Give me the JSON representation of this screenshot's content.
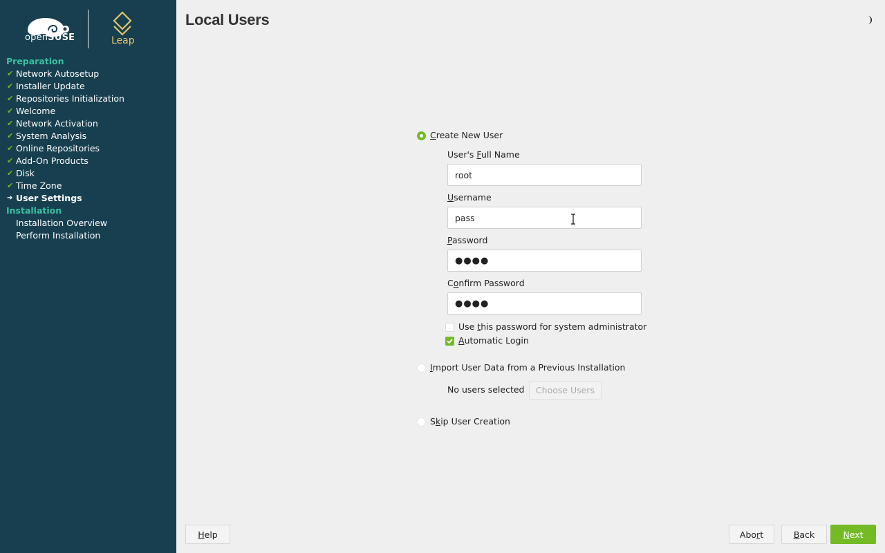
{
  "sidebar": {
    "brand_prefix": "open",
    "brand_suffix": "SUSE",
    "product": "Leap",
    "groups": [
      {
        "title": "Preparation",
        "items": [
          {
            "label": "Network Autosetup",
            "state": "done"
          },
          {
            "label": "Installer Update",
            "state": "done"
          },
          {
            "label": "Repositories Initialization",
            "state": "done"
          },
          {
            "label": "Welcome",
            "state": "done"
          },
          {
            "label": "Network Activation",
            "state": "done"
          },
          {
            "label": "System Analysis",
            "state": "done"
          },
          {
            "label": "Online Repositories",
            "state": "done"
          },
          {
            "label": "Add-On Products",
            "state": "done"
          },
          {
            "label": "Disk",
            "state": "done"
          },
          {
            "label": "Time Zone",
            "state": "done"
          },
          {
            "label": "User Settings",
            "state": "current"
          }
        ]
      },
      {
        "title": "Installation",
        "items": [
          {
            "label": "Installation Overview",
            "state": "pending"
          },
          {
            "label": "Perform Installation",
            "state": "pending"
          }
        ]
      }
    ],
    "done_mark": "✔",
    "current_mark": "➔"
  },
  "page": {
    "title": "Local Users",
    "theme_icon": "half-moon-icon"
  },
  "form": {
    "create_new_user": {
      "label_pre": "",
      "label_acc": "C",
      "label_post": "reate New User",
      "selected": true
    },
    "full_name": {
      "label_pre": "User's ",
      "label_acc": "F",
      "label_post": "ull Name",
      "value": "root"
    },
    "username": {
      "label_pre": "",
      "label_acc": "U",
      "label_post": "sername",
      "value": "pass"
    },
    "password": {
      "label_pre": "",
      "label_acc": "P",
      "label_post": "assword",
      "value": "●●●●"
    },
    "confirm_password": {
      "label_pre": "",
      "label_acc": "o",
      "label_post": "nfirm Password",
      "label_lead": "C",
      "value": "●●●●"
    },
    "admin_password": {
      "label_pre": "Use ",
      "label_acc": "t",
      "label_post": "his password for system administrator",
      "checked": false
    },
    "auto_login": {
      "label_pre": "",
      "label_acc": "A",
      "label_post": "utomatic Login",
      "checked": true
    },
    "import_user_data": {
      "label_pre": "",
      "label_acc": "I",
      "label_post": "mport User Data from a Previous Installation",
      "selected": false
    },
    "no_users_selected": "No users selected",
    "choose_users": "Choose Users",
    "skip_user_creation": {
      "label_pre": "S",
      "label_acc": "k",
      "label_post": "ip User Creation",
      "selected": false
    }
  },
  "footer": {
    "help": {
      "pre": "",
      "acc": "H",
      "post": "elp"
    },
    "abort": {
      "pre": "Abo",
      "acc": "r",
      "post": "t"
    },
    "back": {
      "pre": "",
      "acc": "B",
      "post": "ack"
    },
    "next": {
      "pre": "",
      "acc": "N",
      "post": "ext"
    }
  },
  "colors": {
    "sidebar_bg": "#173f4f",
    "group_title": "#3cc0a2",
    "accent": "#73ba25",
    "leap_gold": "#e6c46b",
    "content_bg": "#efefef"
  }
}
